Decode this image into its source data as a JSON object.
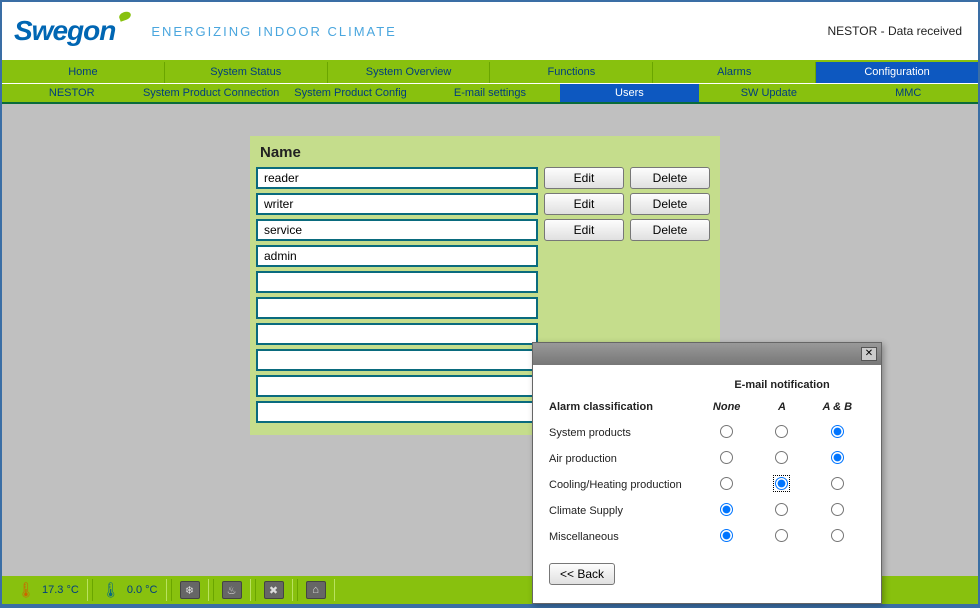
{
  "header": {
    "logo_text": "Swegon",
    "tagline": "ENERGIZING INDOOR CLIMATE",
    "status": "NESTOR - Data received"
  },
  "nav1": [
    {
      "label": "Home",
      "active": false
    },
    {
      "label": "System Status",
      "active": false
    },
    {
      "label": "System Overview",
      "active": false
    },
    {
      "label": "Functions",
      "active": false
    },
    {
      "label": "Alarms",
      "active": false
    },
    {
      "label": "Configuration",
      "active": true
    }
  ],
  "nav2": [
    {
      "label": "NESTOR",
      "active": false
    },
    {
      "label": "System Product Connection",
      "active": false
    },
    {
      "label": "System Product Config",
      "active": false
    },
    {
      "label": "E-mail settings",
      "active": false
    },
    {
      "label": "Users",
      "active": true
    },
    {
      "label": "SW Update",
      "active": false
    },
    {
      "label": "MMC",
      "active": false
    }
  ],
  "panel": {
    "title": "Name",
    "edit_label": "Edit",
    "delete_label": "Delete",
    "rows": [
      {
        "name": "reader",
        "buttons": true
      },
      {
        "name": "writer",
        "buttons": true
      },
      {
        "name": "service",
        "buttons": true
      },
      {
        "name": "admin",
        "buttons": false
      },
      {
        "name": "",
        "buttons": false
      },
      {
        "name": "",
        "buttons": false
      },
      {
        "name": "",
        "buttons": false
      },
      {
        "name": "",
        "buttons": false
      },
      {
        "name": "",
        "buttons": false
      },
      {
        "name": "",
        "buttons": false
      }
    ]
  },
  "dialog": {
    "super_header": "E-mail notification",
    "row_header": "Alarm classification",
    "columns": [
      "None",
      "A",
      "A & B"
    ],
    "rows": [
      {
        "label": "System products",
        "selected": 2
      },
      {
        "label": "Air production",
        "selected": 2
      },
      {
        "label": "Cooling/Heating production",
        "selected": 1,
        "focus": true
      },
      {
        "label": "Climate Supply",
        "selected": 0
      },
      {
        "label": "Miscellaneous",
        "selected": 0
      }
    ],
    "back_label": "<< Back"
  },
  "footer": {
    "temp1": "17.3 °C",
    "temp2": "0.0 °C"
  }
}
